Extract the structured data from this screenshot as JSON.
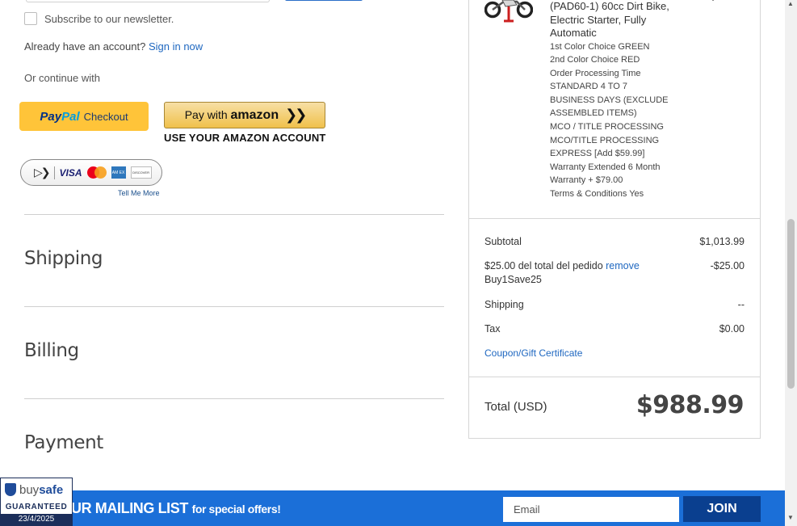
{
  "newsletter": {
    "label": "Subscribe to our newsletter."
  },
  "account": {
    "prompt": "Already have an account?",
    "sign_in_link": "Sign in now"
  },
  "continue_with": "Or continue with",
  "paypal": {
    "pay": "Pay",
    "pal": "Pal",
    "checkout": "Checkout"
  },
  "amazon": {
    "label_pre": "Pay with",
    "label_brand": "amazon",
    "subtitle": "USE YOUR AMAZON ACCOUNT"
  },
  "cards": {
    "visa": "VISA",
    "amex": "AM EX",
    "discover": "DISCOVER",
    "tell_more": "Tell Me More"
  },
  "sections": {
    "shipping": "Shipping",
    "billing": "Billing",
    "payment": "Payment"
  },
  "product": {
    "title": "(PAD60-1) 60cc Dirt Bike, Electric Starter, Fully Automatic",
    "options": [
      "1st Color Choice GREEN",
      "2nd Color Choice RED",
      "Order Processing Time STANDARD 4 TO 7 BUSINESS DAYS (EXCLUDE ASSEMBLED ITEMS)",
      "MCO / TITLE PROCESSING MCO/TITLE PROCESSING EXPRESS [Add $59.99]",
      "Warranty Extended 6 Month Warranty + $79.00",
      "Terms & Conditions Yes"
    ]
  },
  "summary": {
    "subtotal_label": "Subtotal",
    "subtotal_value": "$1,013.99",
    "discount_text": "$25.00 del total del pedido",
    "discount_remove": "remove",
    "discount_code": "Buy1Save25",
    "discount_value": "-$25.00",
    "shipping_label": "Shipping",
    "shipping_value": "--",
    "tax_label": "Tax",
    "tax_value": "$0.00",
    "coupon_link": "Coupon/Gift Certificate",
    "total_label": "Total (USD)",
    "total_value": "$988.99"
  },
  "mailing": {
    "title": "UR MAILING LIST",
    "subtitle": "for special offers!",
    "email_placeholder": "Email",
    "join_label": "JOIN"
  },
  "buysafe": {
    "brand_buy": "buy",
    "brand_safe": "safe",
    "guaranteed": "GUARANTEED",
    "date": "23/4/2025"
  }
}
